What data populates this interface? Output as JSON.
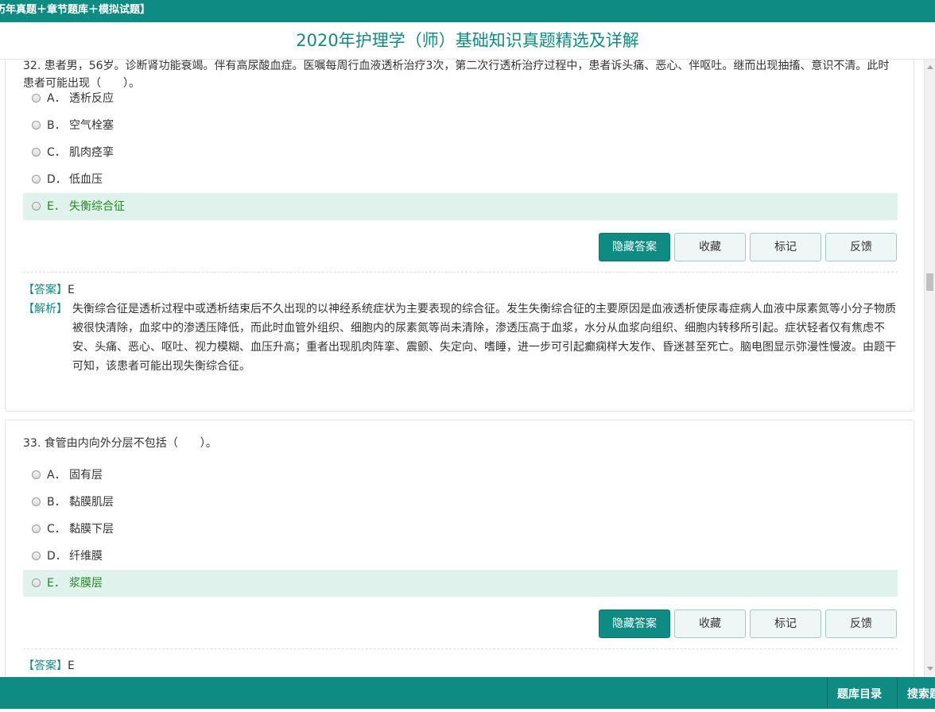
{
  "top_banner": {
    "text": "历年真题＋章节题库＋模拟试题】"
  },
  "page_title": "2020年护理学（师）基础知识真题精选及详解",
  "questions": [
    {
      "stem": "32. 患者男，56岁。诊断肾功能衰竭。伴有高尿酸血症。医嘱每周行血液透析治疗3次，第二次行透析治疗过程中，患者诉头痛、恶心、伴呕吐。继而出现抽搐、意识不清。此时患者可能出现（　　）。",
      "options": [
        {
          "letter": "A．",
          "text": "透析反应"
        },
        {
          "letter": "B．",
          "text": "空气栓塞"
        },
        {
          "letter": "C．",
          "text": "肌肉痉挛"
        },
        {
          "letter": "D．",
          "text": "低血压"
        },
        {
          "letter": "E．",
          "text": "失衡综合征"
        }
      ],
      "answer_tag": "【答案】",
      "answer": "E",
      "analysis_tag": "【解析】",
      "analysis": "失衡综合征是透析过程中或透析结束后不久出现的以神经系统症状为主要表现的综合征。发生失衡综合征的主要原因是血液透析使尿毒症病人血液中尿素氮等小分子物质被很快清除，血浆中的渗透压降低，而此时血管外组织、细胞内的尿素氮等尚未清除，渗透压高于血浆，水分从血浆向组织、细胞内转移所引起。症状轻者仅有焦虑不安、头痛、恶心、呕吐、视力模糊、血压升高；重者出现肌肉阵挛、震颤、失定向、嗜睡，进一步可引起癫痫样大发作、昏迷甚至死亡。脑电图显示弥漫性慢波。由题干可知，该患者可能出现失衡综合征。"
    },
    {
      "stem": "33. 食管由内向外分层不包括（　　）。",
      "options": [
        {
          "letter": "A．",
          "text": "固有层"
        },
        {
          "letter": "B．",
          "text": "黏膜肌层"
        },
        {
          "letter": "C．",
          "text": "黏膜下层"
        },
        {
          "letter": "D．",
          "text": "纤维膜"
        },
        {
          "letter": "E．",
          "text": "浆膜层"
        }
      ],
      "answer_tag": "【答案】",
      "answer": "E"
    }
  ],
  "buttons": {
    "hide_answer": "隐藏答案",
    "favorite": "收藏",
    "mark": "标记",
    "feedback": "反馈"
  },
  "bottom_nav": {
    "catalog": "题库目录",
    "search": "搜索题"
  },
  "colors": {
    "accent": "#0e8b82",
    "correct_bg": "#dff2ec",
    "correct_text": "#1f8a1f"
  }
}
